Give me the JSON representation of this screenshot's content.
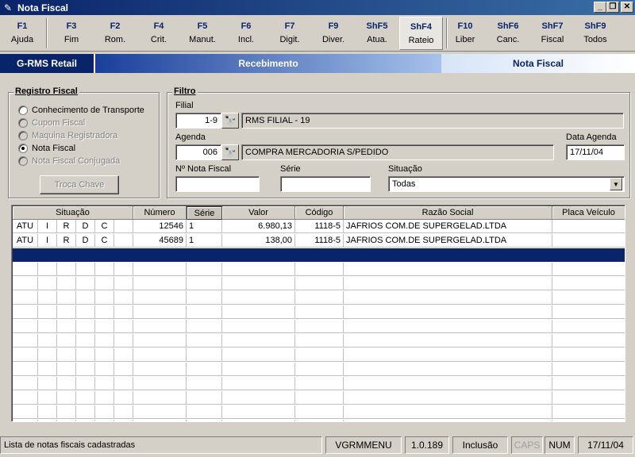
{
  "window": {
    "title": "Nota Fiscal",
    "minimize": "_",
    "maximize": "❐",
    "close": "✕"
  },
  "fkeys": [
    {
      "key": "F1",
      "label": "Ajuda"
    },
    {
      "key": "F3",
      "label": "Fim"
    },
    {
      "key": "F2",
      "label": "Rom."
    },
    {
      "key": "F4",
      "label": "Crit."
    },
    {
      "key": "F5",
      "label": "Manut."
    },
    {
      "key": "F6",
      "label": "Incl."
    },
    {
      "key": "F7",
      "label": "Digit."
    },
    {
      "key": "F9",
      "label": "Diver."
    },
    {
      "key": "ShF5",
      "label": "Atua."
    },
    {
      "key": "ShF4",
      "label": "Rateio"
    },
    {
      "key": "F10",
      "label": "Liber"
    },
    {
      "key": "ShF6",
      "label": "Canc."
    },
    {
      "key": "ShF7",
      "label": "Fiscal"
    },
    {
      "key": "ShF9",
      "label": "Todos"
    }
  ],
  "banner": {
    "left": "G-RMS Retail",
    "middle": "Recebimento",
    "right": "Nota Fiscal"
  },
  "registro": {
    "title": "Registro Fiscal",
    "options": [
      "Conhecimento de Transporte",
      "Cupom Fiscal",
      "Maquina Registradora",
      "Nota Fiscal",
      "Nota Fiscal Conjugada"
    ],
    "button": "Troca Chave"
  },
  "filtro": {
    "title": "Filtro",
    "filial_label": "Filial",
    "filial_code": "1-9",
    "filial_name": "RMS FILIAL - 19",
    "agenda_label": "Agenda",
    "agenda_code": "006",
    "agenda_desc": "COMPRA MERCADORIA S/PEDIDO",
    "data_agenda_label": "Data Agenda",
    "data_agenda": "17/11/04",
    "nota_label": "Nº Nota Fiscal",
    "nota_value": "",
    "serie_label": "Série",
    "serie_value": "",
    "situacao_label": "Situação",
    "situacao_value": "Todas"
  },
  "grid": {
    "headers": [
      "Situação",
      "Número",
      "Série",
      "Valor",
      "Código",
      "Razão Social",
      "Placa Veículo"
    ],
    "rows": [
      [
        "ATU",
        "I",
        "R",
        "D",
        "C",
        "",
        "12546",
        "1",
        "6.980,13",
        "1118-5",
        "JAFRIOS COM.DE SUPERGELAD.LTDA",
        ""
      ],
      [
        "ATU",
        "I",
        "R",
        "D",
        "C",
        "",
        "45689",
        "1",
        "138,00",
        "1118-5",
        "JAFRIOS COM.DE SUPERGELAD.LTDA",
        ""
      ]
    ]
  },
  "status": {
    "message": "Lista de notas fiscais cadastradas",
    "module": "VGRMMENU",
    "version": "1.0.189",
    "mode": "Inclusão",
    "caps": "CAPS",
    "num": "NUM",
    "date": "17/11/04"
  }
}
